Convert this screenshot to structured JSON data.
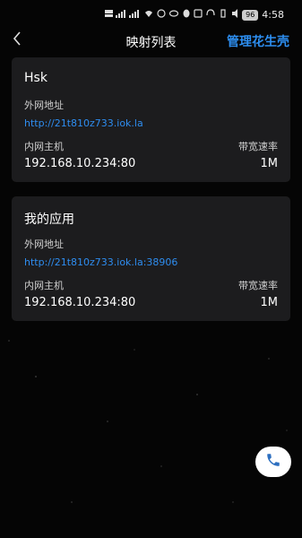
{
  "status_bar": {
    "left_indicators": [
      "HD",
      "5G",
      "4G",
      "LTE",
      "wifi",
      "msg",
      "sync",
      "qq"
    ],
    "right_icons": [
      "nfc-icon",
      "headset-icon",
      "vibrate-icon",
      "sound-icon"
    ],
    "battery": "96",
    "time": "4:58"
  },
  "header": {
    "back_icon": "chevron-left-icon",
    "title": "映射列表",
    "manage_label": "管理花生壳"
  },
  "mappings": [
    {
      "name": "Hsk",
      "external_label": "外网地址",
      "external_url": "http://21t810z733.iok.la",
      "internal_label": "内网主机",
      "internal_host": "192.168.10.234:80",
      "bandwidth_label": "带宽速率",
      "bandwidth": "1M"
    },
    {
      "name": "我的应用",
      "external_label": "外网地址",
      "external_url": "http://21t810z733.iok.la:38906",
      "internal_label": "内网主机",
      "internal_host": "192.168.10.234:80",
      "bandwidth_label": "带宽速率",
      "bandwidth": "1M"
    }
  ],
  "fab": {
    "icon": "phone-icon"
  },
  "colors": {
    "accent": "#2d8ef0",
    "card_bg": "#1c1c1e",
    "page_bg": "#050505"
  }
}
